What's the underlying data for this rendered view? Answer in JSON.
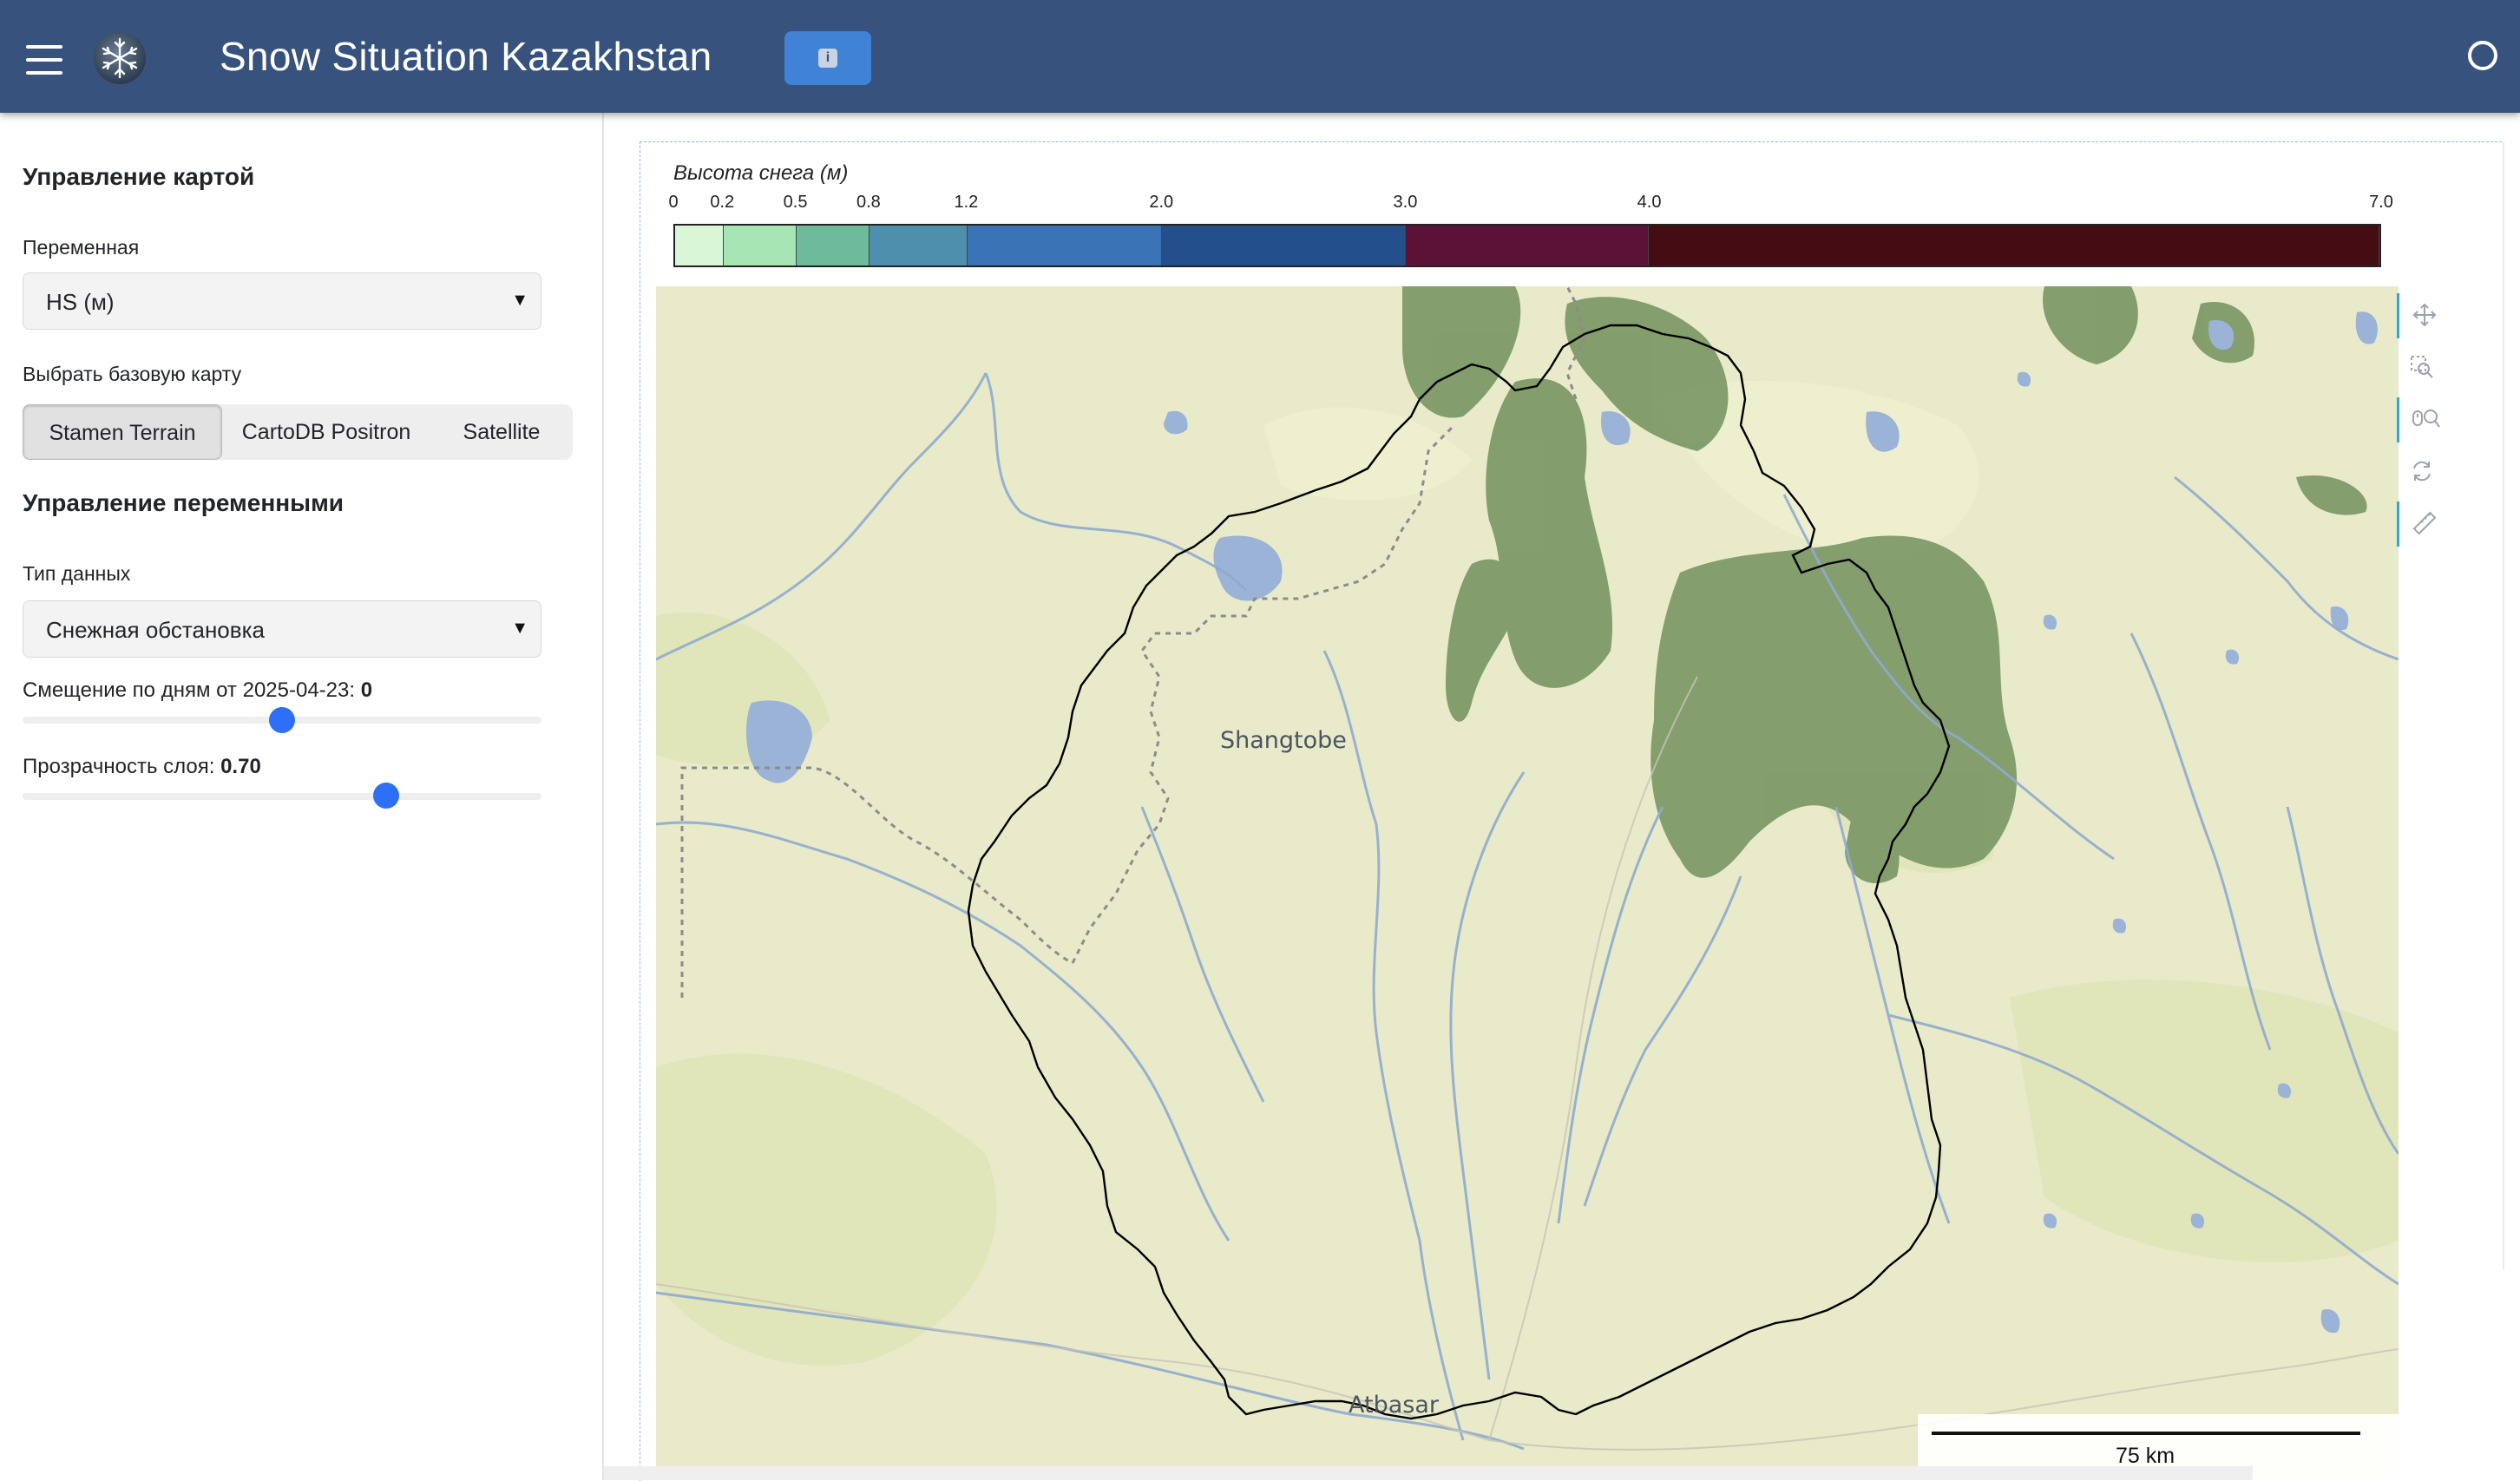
{
  "header": {
    "title": "Snow Situation Kazakhstan",
    "info_icon": "info-icon",
    "menu_icon": "hamburger-icon",
    "logo_icon": "snowflake-logo-icon",
    "status_icon": "circle-status-icon"
  },
  "sidebar": {
    "map_controls_title": "Управление картой",
    "variable_label": "Переменная",
    "variable_value": "HS (м)",
    "basemap_label": "Выбрать базовую карту",
    "basemaps": [
      "Stamen Terrain",
      "CartoDB Positron",
      "Satellite"
    ],
    "basemap_selected": "Stamen Terrain",
    "variable_controls_title": "Управление переменными",
    "data_type_label": "Тип данных",
    "data_type_value": "Снежная обстановка",
    "day_offset_label": "Смещение по дням от 2025-04-23:",
    "day_offset_value": "0",
    "day_offset_fraction": 0.5,
    "opacity_label": "Прозрачность слоя:",
    "opacity_value": "0.70",
    "opacity_fraction": 0.7
  },
  "colorbar": {
    "title": "Высота снега (м)",
    "ticks": [
      "0",
      "0.2",
      "0.5",
      "0.8",
      "1.2",
      "2.0",
      "3.0",
      "4.0",
      "7.0"
    ],
    "tick_values": [
      0,
      0.2,
      0.5,
      0.8,
      1.2,
      2.0,
      3.0,
      4.0,
      7.0
    ],
    "colors": [
      "#d9f7d6",
      "#a6e6b4",
      "#6dbb9a",
      "#4e8fae",
      "#3a73b5",
      "#23508a",
      "#5c1136",
      "#440d14"
    ]
  },
  "map": {
    "places": [
      "Shangtobe",
      "Atbasar"
    ],
    "scale_label": "75 km",
    "colors": {
      "land": "#e8eac9",
      "forest": "#7e9a68",
      "water": "#9ab3d6",
      "river": "#8eabcf",
      "boundary": "#000000"
    }
  },
  "toolbar": {
    "tools": [
      "pan-icon",
      "box-zoom-icon",
      "wheel-zoom-icon",
      "reset-icon",
      "ruler-icon"
    ]
  }
}
